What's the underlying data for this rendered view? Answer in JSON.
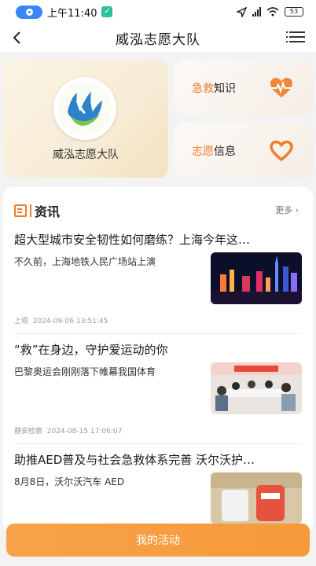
{
  "status_bar": {
    "time": "上午11:40",
    "battery": "53"
  },
  "nav": {
    "title": "威泓志愿大队"
  },
  "hero": {
    "label": "威泓志愿大队"
  },
  "cards": [
    {
      "highlight": "急救",
      "rest": "知识",
      "icon": "heart-pulse-icon"
    },
    {
      "highlight": "志愿",
      "rest": "信息",
      "icon": "heart-icon"
    }
  ],
  "news": {
    "title": "资讯",
    "more": "更多",
    "items": [
      {
        "title": "超大型城市安全韧性如何磨练？上海今年这…",
        "desc": "不久前，上海地铁人民广场站上演",
        "source": "上观",
        "time": "2024-09-06 13:51:45"
      },
      {
        "title": "“救”在身边，守护爱运动的你",
        "desc": "巴黎奥运会刚刚落下帷幕我国体育",
        "source": "静安检察",
        "time": "2024-08-15 17:06:07"
      },
      {
        "title": "助推AED普及与社会急救体系完善 沃尔沃护…",
        "desc": "8月8日，沃尔沃汽车 AED",
        "source": "",
        "time": ""
      }
    ]
  },
  "bottom": {
    "label": "我的活动"
  },
  "colors": {
    "accent": "#f07d2c",
    "button": "#f7a24a"
  }
}
